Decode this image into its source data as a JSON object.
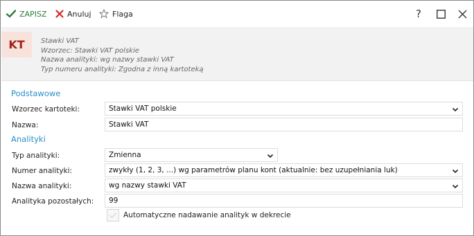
{
  "toolbar": {
    "save_label": "ZAPISZ",
    "cancel_label": "Anuluj",
    "flag_label": "Flaga",
    "help_label": "?"
  },
  "header": {
    "badge": "KT",
    "lines": [
      "Stawki VAT",
      "Wzorzec: Stawki VAT polskie",
      "Nazwa analityki: wg nazwy stawki VAT",
      "Typ numeru analityki: Zgodna z inną kartoteką"
    ]
  },
  "sections": {
    "basic": "Podstawowe",
    "analytics": "Analityki"
  },
  "fields": {
    "template_label": "Wzorzec kartoteki:",
    "template_value": "Stawki VAT polskie",
    "name_label": "Nazwa:",
    "name_value": "Stawki VAT",
    "analytic_type_label": "Typ analityki:",
    "analytic_type_value": "Zmienna",
    "analytic_number_label": "Numer analityki:",
    "analytic_number_value": "zwykły (1, 2, 3, ...) wg parametrów planu kont (aktualnie: bez uzupełniania luk)",
    "analytic_name_label": "Nazwa analityki:",
    "analytic_name_value": "wg nazwy stawki VAT",
    "analytic_rest_label": "Analityka pozostałych:",
    "analytic_rest_value": "99",
    "auto_assign_label": "Automatyczne nadawanie analityk w dekrecie"
  },
  "colors": {
    "save_accent": "#2c7d33",
    "cancel_accent": "#d12a2a",
    "section_title": "#2a8fc9",
    "badge_text": "#a2231b",
    "badge_bg": "#f8e2dc"
  }
}
